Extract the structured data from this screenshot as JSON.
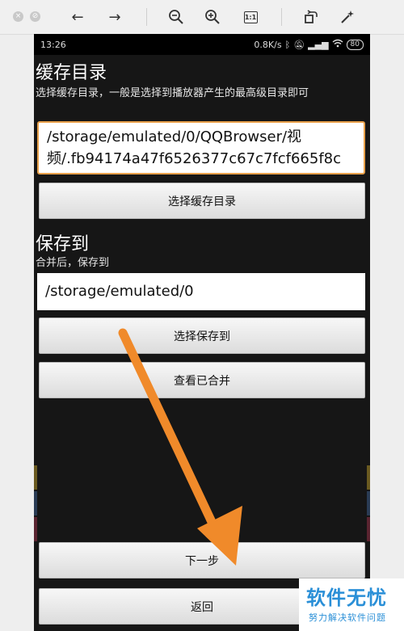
{
  "viewer": {
    "toolbar_icons": [
      "close-icon",
      "minimize-icon",
      "back-arrow-icon",
      "forward-arrow-icon",
      "zoom-out-icon",
      "zoom-in-icon",
      "actual-size-icon",
      "rotate-icon",
      "magic-wand-icon"
    ],
    "actual_size_label": "1:1"
  },
  "status": {
    "time": "13:26",
    "speed": "0.8K/s",
    "battery": "80"
  },
  "cache": {
    "title": "缓存目录",
    "description": "选择缓存目录，一般是选择到播放器产生的最高级目录即可",
    "path": "/storage/emulated/0/QQBrowser/视频/.fb94174a47f6526377c67c7fcf665f8c",
    "button": "选择缓存目录"
  },
  "save": {
    "title": "保存到",
    "description": "合并后，保存到",
    "path": "/storage/emulated/0",
    "choose_button": "选择保存到",
    "view_button": "查看已合并"
  },
  "footer": {
    "next_button": "下一步",
    "back_button": "返回"
  },
  "watermark": {
    "title": "软件无忧",
    "subtitle": "努力解决软件问题"
  },
  "colors": {
    "arrow": "#f08a2a",
    "input_focus": "#e8a04a",
    "watermark": "#2a8fd7"
  }
}
